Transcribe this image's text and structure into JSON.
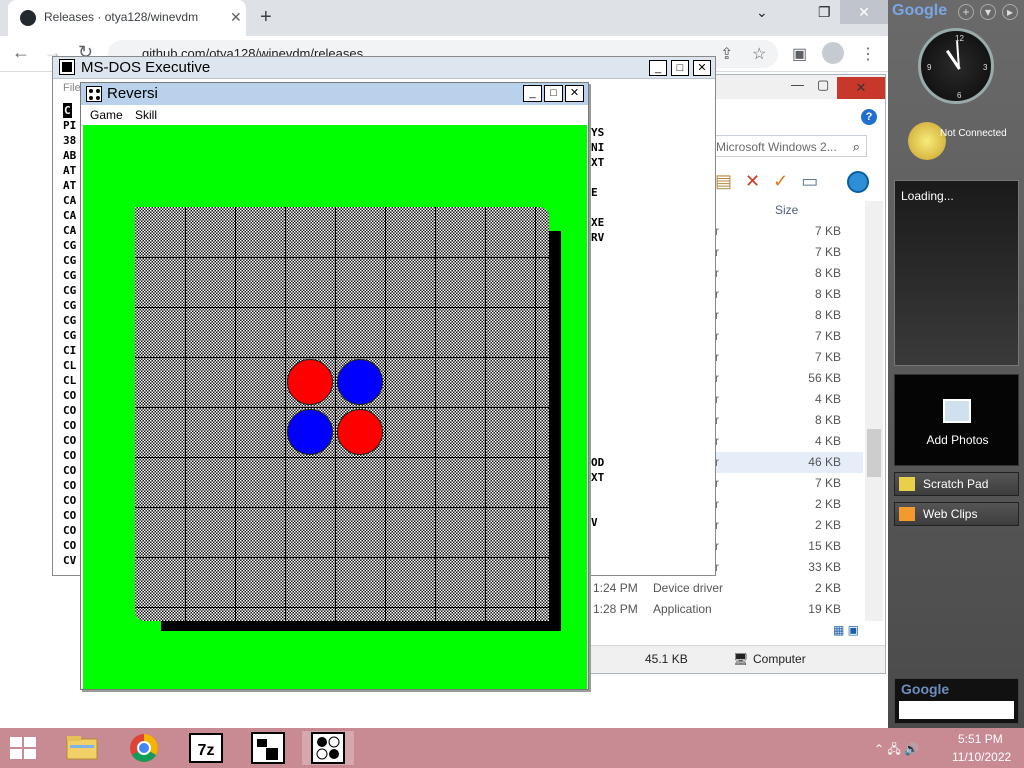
{
  "browser": {
    "tab_title": "Releases · otya128/winevdm",
    "url": "github.com/otya128/winevdm/releases",
    "newtab_glyph": "+",
    "close_glyph": "✕",
    "min_glyph": "⌄",
    "restore_glyph": "❐",
    "back_glyph": "←",
    "forward_glyph": "→",
    "reload_glyph": "↻"
  },
  "explorer": {
    "search_placeholder": "Microsoft Windows 2...",
    "column_size": "Size",
    "rows": [
      {
        "size": "7 KB"
      },
      {
        "size": "7 KB"
      },
      {
        "size": "8 KB"
      },
      {
        "size": "8 KB"
      },
      {
        "size": "8 KB"
      },
      {
        "size": "7 KB"
      },
      {
        "size": "7 KB"
      },
      {
        "size": "56 KB"
      },
      {
        "size": "4 KB"
      },
      {
        "size": "8 KB"
      },
      {
        "size": "4 KB"
      },
      {
        "size": "46 KB",
        "selected": true
      },
      {
        "size": "7 KB"
      },
      {
        "size": "2 KB"
      },
      {
        "size": "2 KB"
      },
      {
        "size": "15 KB"
      },
      {
        "size": "33 KB"
      }
    ],
    "detail_rows": [
      {
        "date": "1:24 PM",
        "type": "Device driver",
        "size": "2 KB"
      },
      {
        "date": "1:28 PM",
        "type": "Application",
        "size": "19 KB"
      }
    ],
    "status_size": "45.1 KB",
    "status_location": "Computer"
  },
  "msdos": {
    "title": "MS-DOS Executive",
    "menu_text": "File",
    "left_column": [
      "C",
      "PI",
      "38",
      "AB",
      "AT",
      "AT",
      "CA",
      "CA",
      "CA",
      "CG",
      "CG",
      "CG",
      "CG",
      "CG",
      "CG",
      "CG",
      "CI",
      "CL",
      "CL",
      "CO",
      "CO",
      "CO",
      "CO",
      "CO",
      "CO",
      "CO",
      "CO",
      "CO",
      "CO",
      "CO",
      "CV"
    ],
    "right_column": [
      "YS",
      "NI",
      "XT",
      "",
      "E",
      "",
      "XE",
      "RV",
      "",
      "",
      "",
      "",
      "",
      "",
      "",
      "",
      "",
      "",
      "",
      "",
      "",
      "",
      "OD",
      "XT",
      "",
      "",
      "V"
    ]
  },
  "reversi": {
    "title": "Reversi",
    "menu": [
      "Game",
      "Skill"
    ],
    "board": {
      "size": 8,
      "pieces": [
        {
          "row": 3,
          "col": 3,
          "color": "red"
        },
        {
          "row": 3,
          "col": 4,
          "color": "blue"
        },
        {
          "row": 4,
          "col": 3,
          "color": "blue"
        },
        {
          "row": 4,
          "col": 4,
          "color": "red"
        }
      ]
    },
    "colors": {
      "field": "#00ff00",
      "red": "#ff0000",
      "blue": "#0000ff"
    }
  },
  "sidebar": {
    "logo": "Google",
    "weather_status": "Not Connected",
    "feed_status": "Loading...",
    "photos_label": "Add Photos",
    "gadgets": [
      "Scratch Pad",
      "Web Clips"
    ],
    "search_logo": "Google"
  },
  "taskbar": {
    "time": "5:51 PM",
    "date": "11/10/2022",
    "apps": [
      "explorer-icon",
      "chrome-icon",
      "7zip-icon",
      "msdos-executive-icon",
      "reversi-icon"
    ]
  }
}
